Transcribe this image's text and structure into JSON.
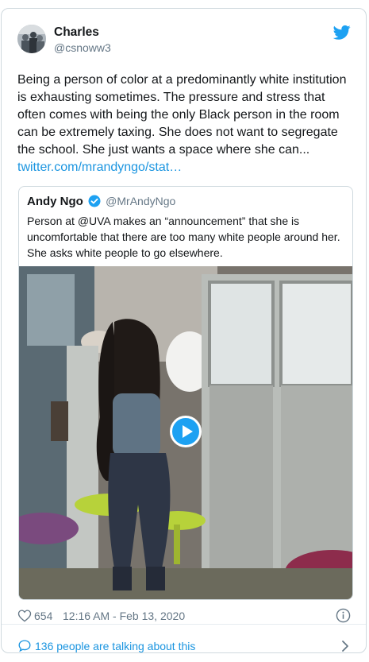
{
  "tweet": {
    "author_name": "Charles",
    "author_handle": "@csnoww3",
    "text": "Being a person of color at a predominantly white institution is exhausting sometimes. The pressure and stress that often comes with being the only Black person in the room can be extremely taxing. She does not want to segregate the school. She just wants a space where she can...",
    "link_text": "twitter.com/mrandyngo/stat…",
    "likes": "654",
    "timestamp": "12:16 AM - Feb 13, 2020",
    "talking": "136 people are talking about this"
  },
  "quoted": {
    "author_name": "Andy Ngo",
    "author_handle": "@MrAndyNgo",
    "text": "Person at @UVA makes an “announcement” that she is uncomfortable that there are too many white people around her. She asks white people to go elsewhere."
  },
  "icons": {
    "brand": "twitter-bird-icon",
    "verified": "verified-badge-icon",
    "like": "heart-icon",
    "info": "info-icon",
    "talk": "speech-bubble-icon",
    "next": "chevron-right-icon",
    "play": "play-icon"
  },
  "colors": {
    "accent": "#1da1f2",
    "link": "#1b95e0",
    "muted": "#657786",
    "border": "#cfd9de"
  }
}
